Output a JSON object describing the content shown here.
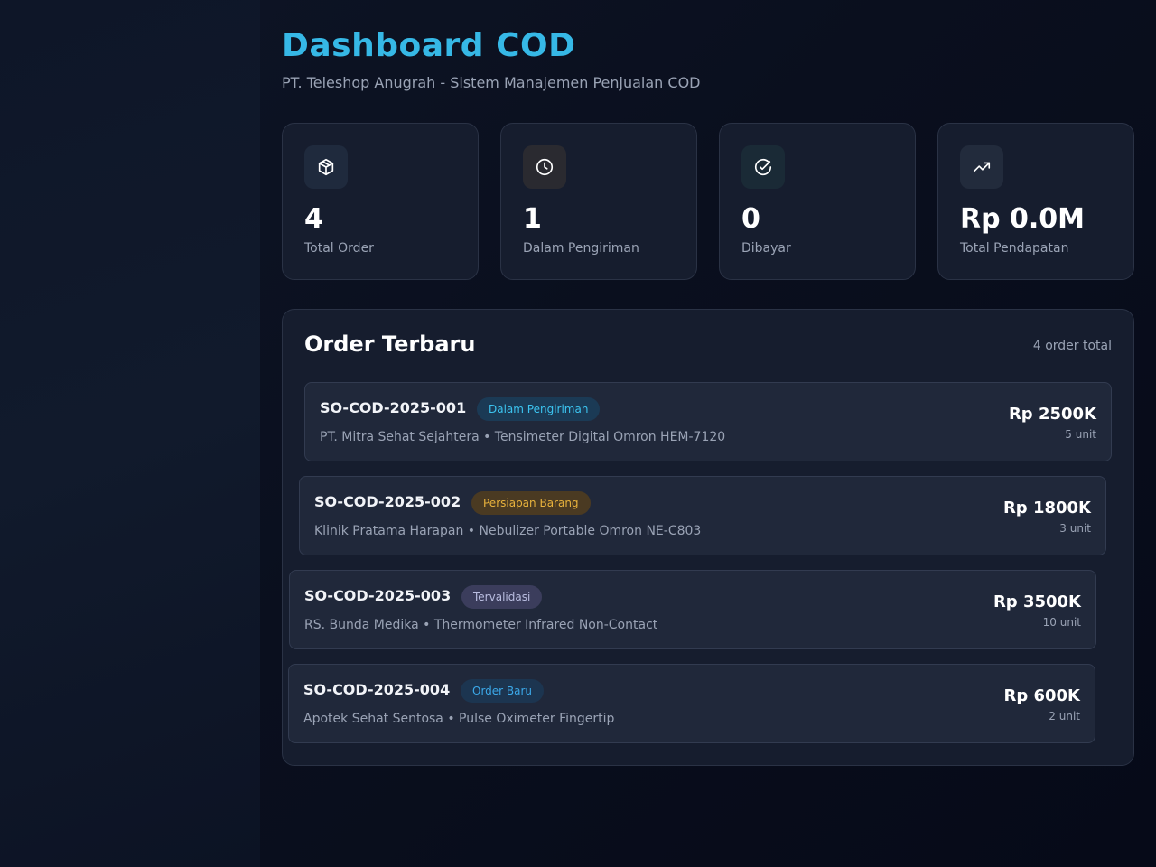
{
  "header": {
    "title": "Dashboard COD",
    "subtitle": "PT. Teleshop Anugrah - Sistem Manajemen Penjualan COD"
  },
  "stats": [
    {
      "icon": "package-icon",
      "value": "4",
      "label": "Total Order",
      "color": "#ffffff"
    },
    {
      "icon": "clock-icon",
      "value": "1",
      "label": "Dalam Pengiriman",
      "color": "#ffffff"
    },
    {
      "icon": "check-circle-icon",
      "value": "0",
      "label": "Dibayar",
      "color": "#ffffff"
    },
    {
      "icon": "trending-up-icon",
      "value": "Rp 0.0M",
      "label": "Total Pendapatan",
      "color": "#ffffff"
    }
  ],
  "orders": {
    "title": "Order Terbaru",
    "count_label": "4 order total",
    "items": [
      {
        "id": "SO-COD-2025-001",
        "status": "Dalam Pengiriman",
        "status_color": "#3cc4f0",
        "status_bg": "#1b3a55",
        "description": "PT. Mitra Sehat Sejahtera • Tensimeter Digital Omron HEM-7120",
        "price": "Rp 2500K",
        "qty": "5 unit"
      },
      {
        "id": "SO-COD-2025-002",
        "status": "Persiapan Barang",
        "status_color": "#e8b23c",
        "status_bg": "#4a3a22",
        "description": "Klinik Pratama Harapan • Nebulizer Portable Omron NE-C803",
        "price": "Rp 1800K",
        "qty": "3 unit"
      },
      {
        "id": "SO-COD-2025-003",
        "status": "Tervalidasi",
        "status_color": "#b9bde0",
        "status_bg": "#3b3d5c",
        "description": "RS. Bunda Medika • Thermometer Infrared Non-Contact",
        "price": "Rp 3500K",
        "qty": "10 unit"
      },
      {
        "id": "SO-COD-2025-004",
        "status": "Order Baru",
        "status_color": "#3ba8e8",
        "status_bg": "#1c3550",
        "description": "Apotek Sehat Sentosa • Pulse Oximeter Fingertip",
        "price": "Rp 600K",
        "qty": "2 unit"
      }
    ]
  }
}
